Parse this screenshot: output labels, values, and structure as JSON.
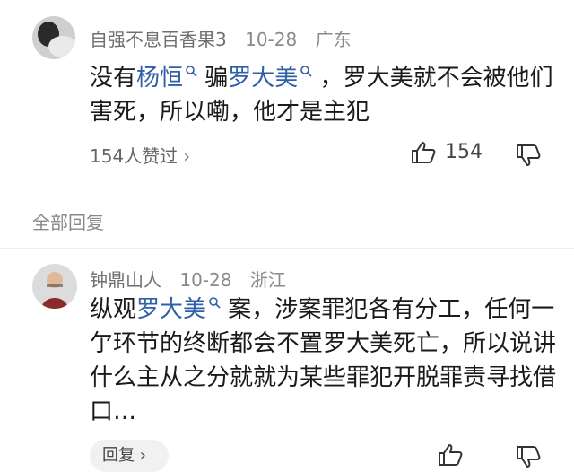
{
  "comment1": {
    "username": "自强不息百香果3",
    "date": "10-28",
    "location": "广东",
    "text_part1": "没有",
    "tag1": "杨恒",
    "text_part2": " 骗",
    "tag2": "罗大美",
    "text_part3": " ，罗大美就不会被他们害死，所以嘞，他才是主犯",
    "likes_summary": "154人赞过",
    "like_count": "154"
  },
  "section_title": "全部回复",
  "comment2": {
    "username": "钟鼎山人",
    "date": "10-28",
    "location": "浙江",
    "text_part1": "纵观",
    "tag1": "罗大美",
    "text_part2": " 案，涉案罪犯各有分工，任何一亇环节的终断都会不置罗大美死亡，所以说讲什么主从之分就就为某些罪犯开脱罪责寻找借口…",
    "reply_label": "回复"
  }
}
